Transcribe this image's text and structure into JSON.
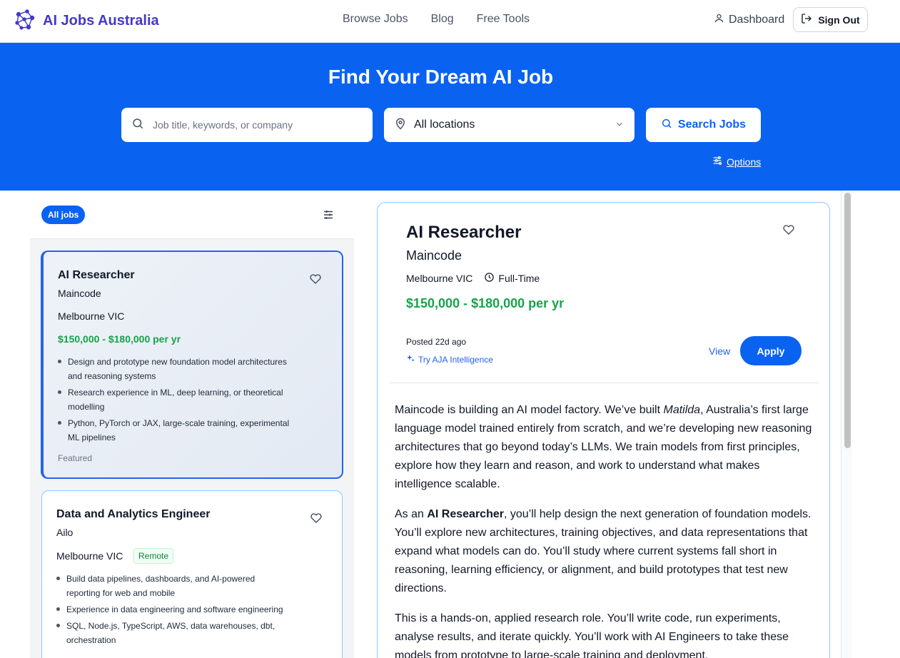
{
  "header": {
    "brand": "AI Jobs Australia",
    "nav": [
      "Browse Jobs",
      "Blog",
      "Free Tools"
    ],
    "dashboard": "Dashboard",
    "sign_out": "Sign Out"
  },
  "hero": {
    "title": "Find Your Dream AI Job",
    "search_placeholder": "Job title, keywords, or company",
    "location_value": "All locations",
    "search_button": "Search Jobs",
    "options_label": "Options"
  },
  "filters": {
    "all_jobs": "All jobs"
  },
  "jobs": [
    {
      "title": "AI Researcher",
      "company": "Maincode",
      "location": "Melbourne VIC",
      "salary": "$150,000 - $180,000 per yr",
      "bullets": [
        "Design and prototype new foundation model architectures and reasoning systems",
        "Research experience in ML, deep learning, or theoretical modelling",
        "Python, PyTorch or JAX, large-scale training, experimental ML pipelines"
      ],
      "tag": "Featured"
    },
    {
      "title": "Data and Analytics Engineer",
      "company": "Ailo",
      "location": "Melbourne VIC",
      "badge": "Remote",
      "bullets": [
        "Build data pipelines, dashboards, and AI-powered reporting for web and mobile",
        "Experience in data engineering and software engineering",
        "SQL, Node.js, TypeScript, AWS, data warehouses, dbt, orchestration"
      ]
    }
  ],
  "detail": {
    "title": "AI Researcher",
    "company": "Maincode",
    "location": "Melbourne VIC",
    "job_type": "Full-Time",
    "salary": "$150,000 - $180,000 per yr",
    "posted": "Posted 22d ago",
    "intelligence": "Try AJA Intelligence",
    "view": "View",
    "apply": "Apply",
    "p1_a": "Maincode is building an AI model factory. We’ve built ",
    "p1_em": "Matilda",
    "p1_b": ", Australia’s first large language model trained entirely from scratch, and we’re developing new reasoning architectures that go beyond today’s LLMs. We train models from first principles, explore how they learn and reason, and work to understand what makes intelligence scalable.",
    "p2_a": "As an ",
    "p2_strong": "AI Researcher",
    "p2_b": ", you’ll help design the next generation of foundation models. You’ll explore new architectures, training objectives, and data representations that expand what models can do. You’ll study where current systems fall short in reasoning, learning efficiency, or alignment, and build prototypes that test new directions.",
    "p3": "This is a hands-on, applied research role. You’ll write code, run experiments, analyse results, and iterate quickly. You’ll work with AI Engineers to take these models from prototype to large-scale training and deployment."
  },
  "colors": {
    "brand": "#4338ca",
    "hero_bg": "#0a62f0",
    "salary": "#16a34a",
    "accent": "#2563eb"
  }
}
